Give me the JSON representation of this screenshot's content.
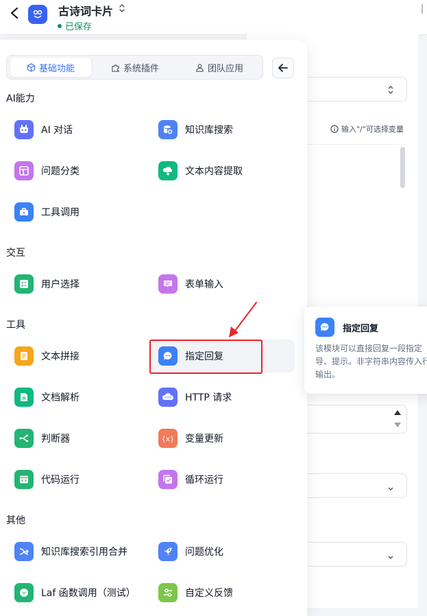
{
  "header": {
    "app_title": "古诗词卡片",
    "save_status": "已保存"
  },
  "editor": {
    "variable_hint": "输入\"/\"可选择变量"
  },
  "tabs": [
    {
      "label": "基础功能",
      "active": true
    },
    {
      "label": "系统插件",
      "active": false
    },
    {
      "label": "团队应用",
      "active": false
    }
  ],
  "sections": [
    {
      "title": "AI能力",
      "items": [
        "AI 对话",
        "知识库搜索",
        "问题分类",
        "文本内容提取",
        "工具调用"
      ]
    },
    {
      "title": "交互",
      "items": [
        "用户选择",
        "表单输入"
      ]
    },
    {
      "title": "工具",
      "items": [
        "文本拼接",
        "指定回复",
        "文档解析",
        "HTTP 请求",
        "判断器",
        "变量更新",
        "代码运行",
        "循环运行"
      ]
    },
    {
      "title": "其他",
      "items": [
        "知识库搜索引用合并",
        "问题优化",
        "Laf 函数调用（测试）",
        "自定义反馈"
      ]
    }
  ],
  "tooltip": {
    "title": "指定回复",
    "description": "该模块可以直接回复一段指定导、提示。非字符串内容传入行输出。"
  },
  "colors": {
    "accent": "#3370ff",
    "saved": "#11945f",
    "highlight_border": "#e5262c"
  }
}
